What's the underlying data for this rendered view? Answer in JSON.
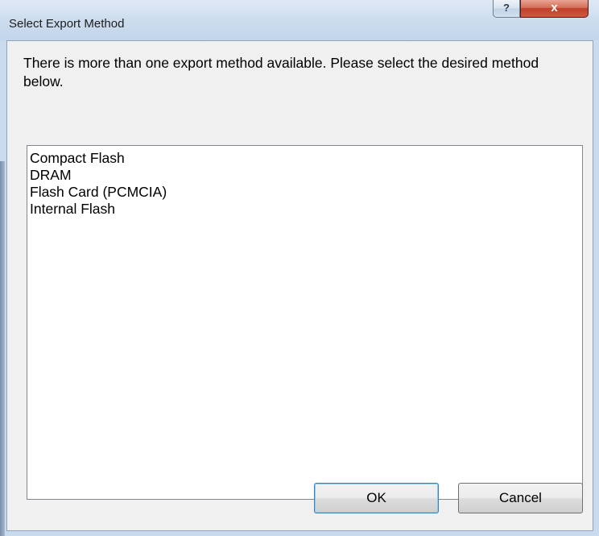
{
  "window": {
    "title": "Select Export Method",
    "help_label": "?",
    "close_label": "x"
  },
  "message": "There is more than one export method available. Please select the desired method below.",
  "methods": [
    {
      "label": "Compact Flash"
    },
    {
      "label": "DRAM"
    },
    {
      "label": "Flash Card (PCMCIA)"
    },
    {
      "label": "Internal Flash"
    }
  ],
  "buttons": {
    "ok_label": "OK",
    "cancel_label": "Cancel"
  }
}
